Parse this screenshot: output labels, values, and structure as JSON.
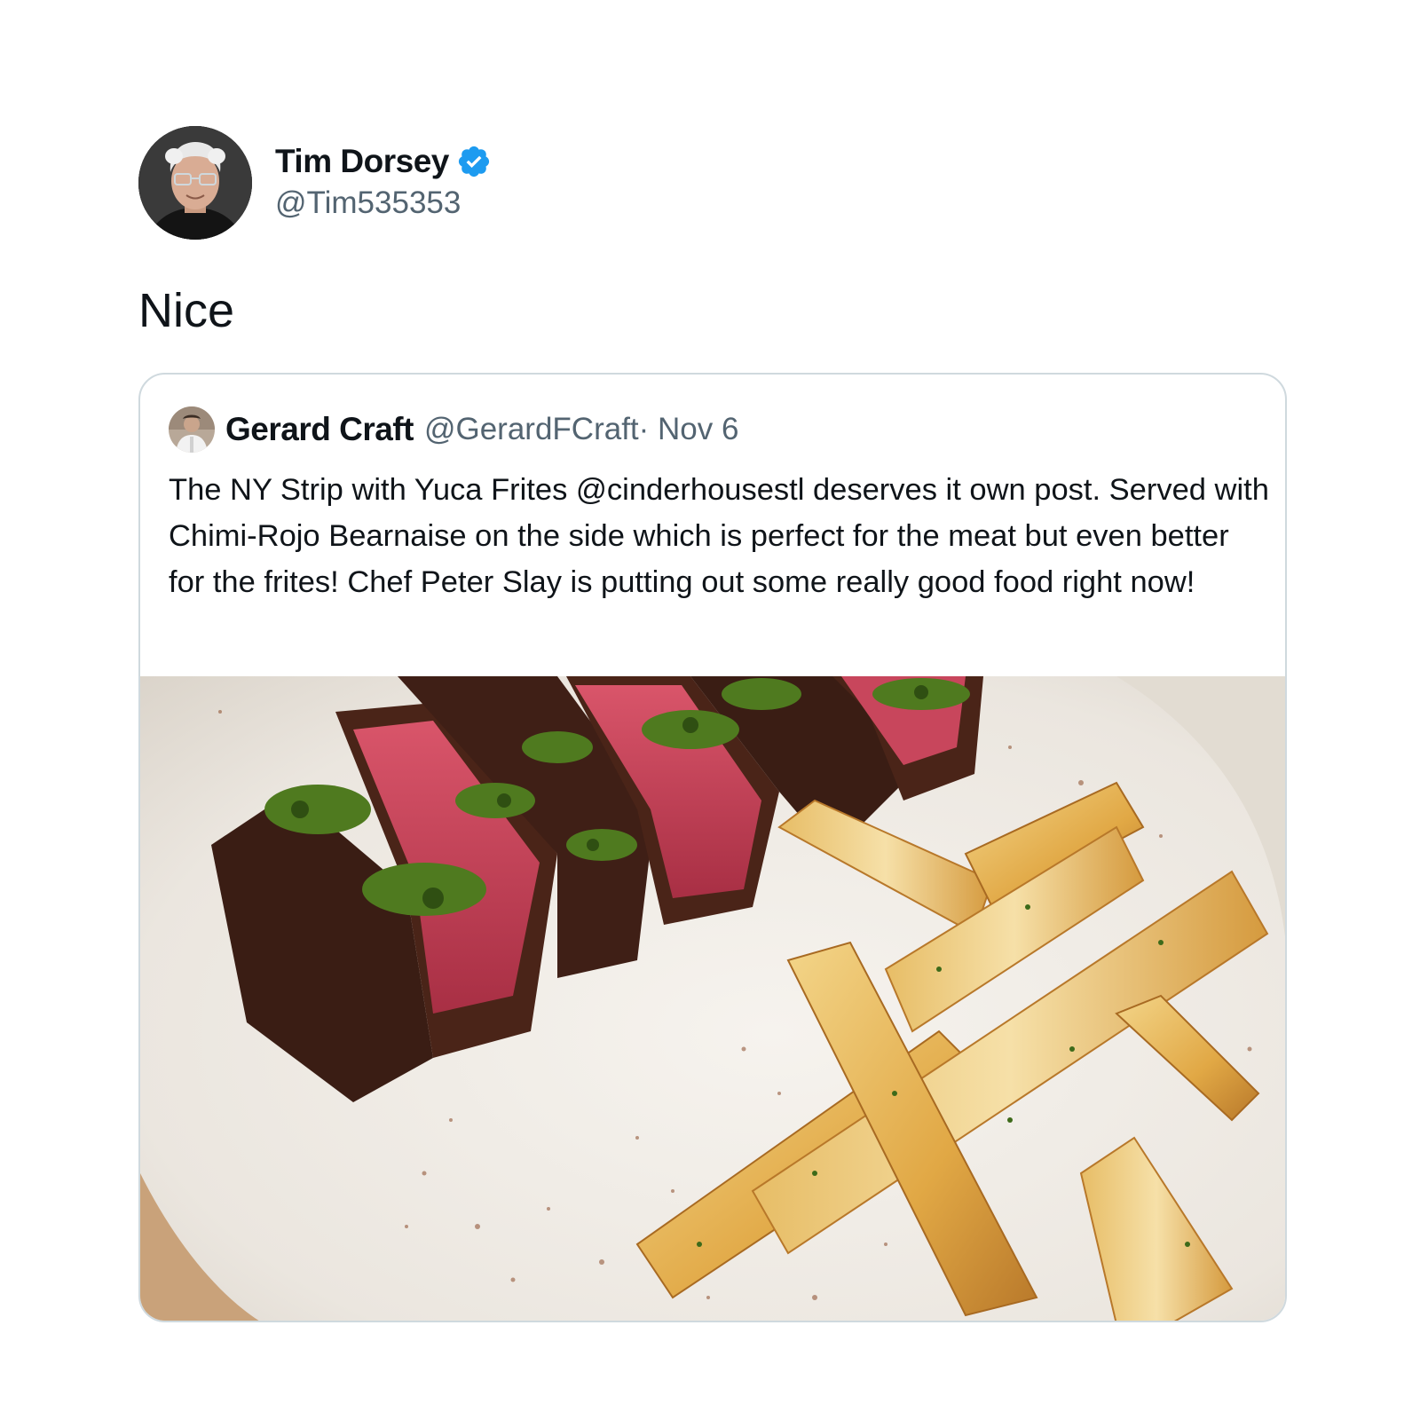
{
  "tweet": {
    "author": {
      "display_name": "Tim Dorsey",
      "handle": "@Tim535353",
      "verified": true,
      "avatar_icon": "profile-photo-avatar"
    },
    "text": "Nice"
  },
  "quoted_tweet": {
    "author": {
      "display_name": "Gerard Craft",
      "handle": "@GerardFCraft",
      "avatar_icon": "profile-photo-avatar"
    },
    "date": "· Nov 6",
    "text": "The NY Strip with Yuca Frites @cinderhousestl deserves it own post. Served with Chimi-Rojo Bearnaise on the side which is perfect for the meat but even better for the frites! Chef Peter Slay is putting out some really good food right now!",
    "media": {
      "type": "photo",
      "description_icon": "food-photo"
    }
  },
  "colors": {
    "text_primary": "#0f1419",
    "text_secondary": "#536471",
    "verified_blue": "#1d9bf0",
    "card_border": "#cfd9de"
  }
}
